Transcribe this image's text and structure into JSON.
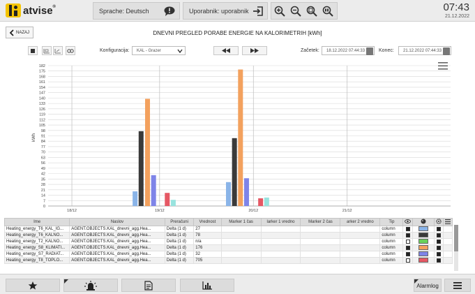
{
  "app": {
    "logo_text": "atvise",
    "logo_reg": "®"
  },
  "header": {
    "language_label": "Sprache: Deutsch",
    "user_label": "Uporabnik: uporabnik",
    "clock_time": "07:43",
    "clock_date": "21.12.2022"
  },
  "toolbar": {
    "back_label": "NAZAJ",
    "title": "DNEVNI PREGLED PORABE ENERGIE NA KALORIMETRIH [kWh]",
    "config_label": "Konfiguracija:",
    "config_value": "KAL - Grazer",
    "start_label": "Začetek:",
    "start_value": "18.12.2022 07:44:33",
    "end_label": "Konec:",
    "end_value": "21.12.2022 07:44:33"
  },
  "chart_data": {
    "type": "bar",
    "ylabel": "kWh",
    "ylim": [
      0,
      182
    ],
    "yticks": [
      0,
      7,
      14,
      21,
      28,
      35,
      42,
      49,
      56,
      63,
      70,
      77,
      84,
      91,
      98,
      105,
      112,
      119,
      126,
      133,
      140,
      147,
      154,
      161,
      168,
      175,
      182
    ],
    "xlim": [
      0,
      100
    ],
    "xticks": [
      {
        "label": "18/12",
        "pos": 5.9
      },
      {
        "label": "19/12",
        "pos": 27.7
      },
      {
        "label": "20/12",
        "pos": 51.0
      },
      {
        "label": "21/12",
        "pos": 74.3
      }
    ],
    "series": [
      {
        "name": "Heating_energy_T6_KAL_IG...",
        "color": "#8ab4e8",
        "bars": [
          {
            "pos": 21.6,
            "value": 19
          },
          {
            "pos": 44.8,
            "value": 31
          }
        ]
      },
      {
        "name": "Heating_energy_T6_KALNO...",
        "color": "#3a3a3a",
        "bars": [
          {
            "pos": 23.1,
            "value": 97
          },
          {
            "pos": 46.3,
            "value": 88
          }
        ]
      },
      {
        "name": "Heating_energy_T2_KALNO...",
        "color": "#f3a15e",
        "bars": [
          {
            "pos": 24.7,
            "value": 139
          },
          {
            "pos": 47.8,
            "value": 177
          }
        ]
      },
      {
        "name": "Heating_energy_S8_KLIMATI...",
        "color": "#7e84e8",
        "bars": [
          {
            "pos": 26.2,
            "value": 40
          },
          {
            "pos": 49.3,
            "value": 36
          }
        ]
      },
      {
        "name": "Heating_energy_S7_RADIAT...",
        "color": "#e55864",
        "bars": [
          {
            "pos": 29.6,
            "value": 17
          },
          {
            "pos": 52.8,
            "value": 10
          }
        ]
      },
      {
        "name": "Heating_energy_T8_TOPLO...",
        "color": "#98e3de",
        "bars": [
          {
            "pos": 31.1,
            "value": 8
          },
          {
            "pos": 54.3,
            "value": 11
          }
        ]
      }
    ]
  },
  "table": {
    "columns": [
      "Ime",
      "Naslov",
      "Preračuni",
      "Vrednost",
      "Marker 1 čas",
      "larker 1 vredno",
      "Marker 2 čas",
      "arker 2 vredno",
      "Tip"
    ],
    "rows": [
      {
        "ime": "Heating_energy_T6_KAL_IG...",
        "naslov": "AGENT.OBJECTS.KAL_dnevni_agg.Hea...",
        "preracuni": "Delta (1 d)",
        "vrednost": "27",
        "m1c": "",
        "m1v": "",
        "m2c": "",
        "m2v": "",
        "tip": "column",
        "visible": true,
        "color": "#8ab4e8"
      },
      {
        "ime": "Heating_energy_T6_KALNO...",
        "naslov": "AGENT.OBJECTS.KAL_dnevni_agg.Hea...",
        "preracuni": "Delta (1 d)",
        "vrednost": "78",
        "m1c": "",
        "m1v": "",
        "m2c": "",
        "m2v": "",
        "tip": "column",
        "visible": true,
        "color": "#3a3a3a"
      },
      {
        "ime": "Heating_energy_T2_KALNO...",
        "naslov": "AGENT.OBJECTS.KAL_dnevni_agg.Hea...",
        "preracuni": "Delta (1 d)",
        "vrednost": "n/a",
        "m1c": "",
        "m1v": "",
        "m2c": "",
        "m2v": "",
        "tip": "column",
        "visible": false,
        "color": "#67d15a"
      },
      {
        "ime": "Heating_energy_S8_KLIMATI...",
        "naslov": "AGENT.OBJECTS.KAL_dnevni_agg.Hea...",
        "preracuni": "Delta (1 d)",
        "vrednost": "176",
        "m1c": "",
        "m1v": "",
        "m2c": "",
        "m2v": "",
        "tip": "column",
        "visible": true,
        "color": "#f3a15e"
      },
      {
        "ime": "Heating_energy_S7_RADIAT...",
        "naslov": "AGENT.OBJECTS.KAL_dnevni_agg.Hea...",
        "preracuni": "Delta (1 d)",
        "vrednost": "32",
        "m1c": "",
        "m1v": "",
        "m2c": "",
        "m2v": "",
        "tip": "column",
        "visible": true,
        "color": "#7e84e8"
      },
      {
        "ime": "Heating_energy_T8_TOPLO...",
        "naslov": "AGENT.OBJECTS.KAL_dnevni_agg.Hea...",
        "preracuni": "Delta (1 d)",
        "vrednost": "705",
        "m1c": "",
        "m1v": "",
        "m2c": "",
        "m2v": "",
        "tip": "column",
        "visible": false,
        "color": "#e55864"
      }
    ]
  },
  "footer": {
    "alarmlog_label": "Alarmlog"
  },
  "icons": {
    "language": "speech-bubble-icon",
    "logout": "logout-icon",
    "zoom_in": "zoom-in-icon",
    "zoom_out": "zoom-out-icon",
    "zoom_fit": "zoom-fit-icon",
    "zoom_reset": "zoom-reset-icon",
    "favorites": "star-icon",
    "alarms": "alarm-light-icon",
    "reports": "document-icon",
    "trends": "bar-chart-icon",
    "menu": "hamburger-menu-icon"
  }
}
